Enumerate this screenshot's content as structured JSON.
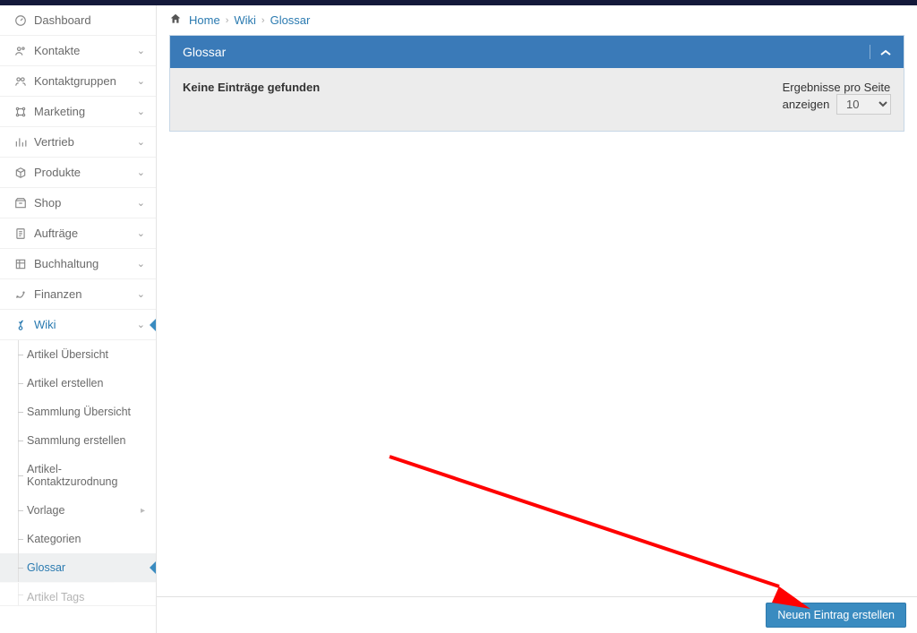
{
  "sidebar": {
    "items": [
      {
        "label": "Dashboard",
        "icon": "dashboard"
      },
      {
        "label": "Kontakte",
        "icon": "contacts",
        "expandable": true
      },
      {
        "label": "Kontaktgruppen",
        "icon": "groups",
        "expandable": true
      },
      {
        "label": "Marketing",
        "icon": "marketing",
        "expandable": true
      },
      {
        "label": "Vertrieb",
        "icon": "sales",
        "expandable": true
      },
      {
        "label": "Produkte",
        "icon": "products",
        "expandable": true
      },
      {
        "label": "Shop",
        "icon": "shop",
        "expandable": true
      },
      {
        "label": "Aufträge",
        "icon": "orders",
        "expandable": true
      },
      {
        "label": "Buchhaltung",
        "icon": "accounting",
        "expandable": true
      },
      {
        "label": "Finanzen",
        "icon": "finance",
        "expandable": true
      },
      {
        "label": "Wiki",
        "icon": "wiki",
        "expandable": true,
        "active": true
      }
    ],
    "wiki_sub": [
      {
        "label": "Artikel Übersicht"
      },
      {
        "label": "Artikel erstellen"
      },
      {
        "label": "Sammlung Übersicht"
      },
      {
        "label": "Sammlung erstellen"
      },
      {
        "label": "Artikel-Kontaktzurodnung"
      },
      {
        "label": "Vorlage",
        "has_submenu": true
      },
      {
        "label": "Kategorien"
      },
      {
        "label": "Glossar",
        "active": true
      },
      {
        "label": "Artikel Tags",
        "cut": true
      }
    ]
  },
  "breadcrumb": {
    "home": "Home",
    "level1": "Wiki",
    "level2": "Glossar"
  },
  "panel": {
    "title": "Glossar",
    "empty_message": "Keine Einträge gefunden",
    "results_label_1": "Ergebnisse pro Seite",
    "results_label_2": "anzeigen",
    "results_value": "10"
  },
  "footer": {
    "create_button": "Neuen Eintrag erstellen"
  }
}
